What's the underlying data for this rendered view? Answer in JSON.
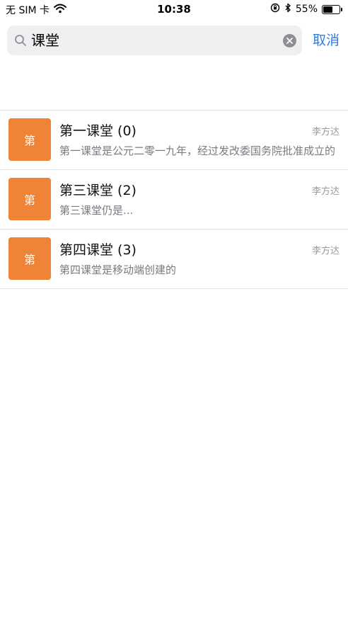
{
  "status_bar": {
    "carrier": "无 SIM 卡",
    "time": "10:38",
    "battery_percent_label": "55%",
    "battery_level": 0.55
  },
  "search": {
    "query": "课堂",
    "cancel_label": "取消"
  },
  "results": [
    {
      "avatar_label": "第",
      "title": "第一课堂 (0)",
      "author": "李方达",
      "description": "第一课堂是公元二零一九年，经过发改委国务院批准成立的"
    },
    {
      "avatar_label": "第",
      "title": "第三课堂 (2)",
      "author": "李方达",
      "description": "第三课堂仍是..."
    },
    {
      "avatar_label": "第",
      "title": "第四课堂 (3)",
      "author": "李方达",
      "description": "第四课堂是移动端创建的"
    }
  ],
  "colors": {
    "accent": "#2b7de0",
    "avatar_bg": "#ef8336",
    "search_bg": "#efeff1"
  }
}
